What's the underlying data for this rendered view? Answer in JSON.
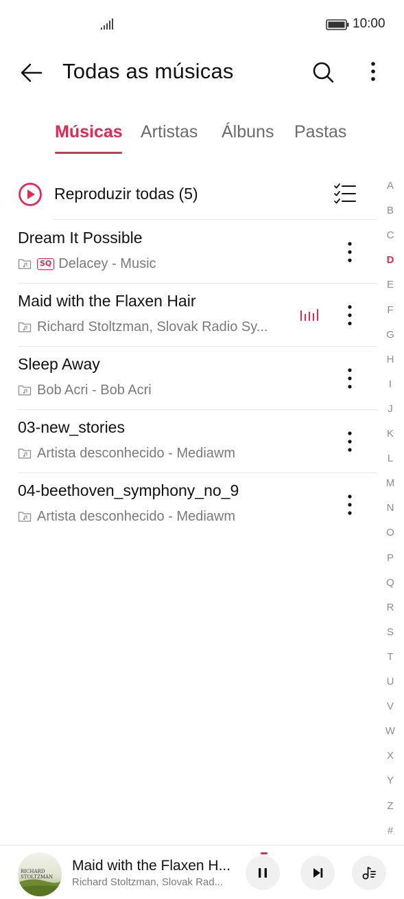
{
  "status_bar": {
    "time": "10:00"
  },
  "header": {
    "title": "Todas as músicas"
  },
  "tabs": [
    {
      "label": "Músicas",
      "active": true
    },
    {
      "label": "Artistas",
      "active": false
    },
    {
      "label": "Álbuns",
      "active": false
    },
    {
      "label": "Pastas",
      "active": false
    }
  ],
  "play_all": {
    "label": "Reproduzir todas (5)"
  },
  "songs": [
    {
      "title": "Dream It Possible",
      "subtitle": "Delacey - Music",
      "sq_badge": "SQ",
      "playing": false
    },
    {
      "title": "Maid with the Flaxen Hair",
      "subtitle": "Richard Stoltzman, Slovak Radio Sy...",
      "playing": true
    },
    {
      "title": "Sleep Away",
      "subtitle": "Bob Acri - Bob Acri",
      "playing": false
    },
    {
      "title": "03-new_stories",
      "subtitle": "Artista desconhecido - Mediawm",
      "playing": false
    },
    {
      "title": "04-beethoven_symphony_no_9",
      "subtitle": "Artista desconhecido - Mediawm",
      "playing": false
    }
  ],
  "alphabet": [
    "A",
    "B",
    "C",
    "D",
    "E",
    "F",
    "G",
    "H",
    "I",
    "J",
    "K",
    "L",
    "M",
    "N",
    "O",
    "P",
    "Q",
    "R",
    "S",
    "T",
    "U",
    "V",
    "W",
    "X",
    "Y",
    "Z",
    "#"
  ],
  "alphabet_active": "D",
  "mini_player": {
    "title": "Maid with the Flaxen H...",
    "subtitle": "Richard Stoltzman, Slovak Rad...",
    "album_text_line1": "RICHARD",
    "album_text_line2": "STOLTZMAN"
  },
  "colors": {
    "accent": "#e5284f",
    "text": "#111111",
    "secondary": "#7a7a7a"
  },
  "icons": [
    "signal-icon",
    "battery-icon",
    "back-arrow-icon",
    "search-icon",
    "more-vertical-icon",
    "play-circle-icon",
    "sort-list-icon",
    "folder-music-icon",
    "equalizer-icon",
    "pause-icon",
    "skip-next-icon",
    "playlist-icon"
  ]
}
